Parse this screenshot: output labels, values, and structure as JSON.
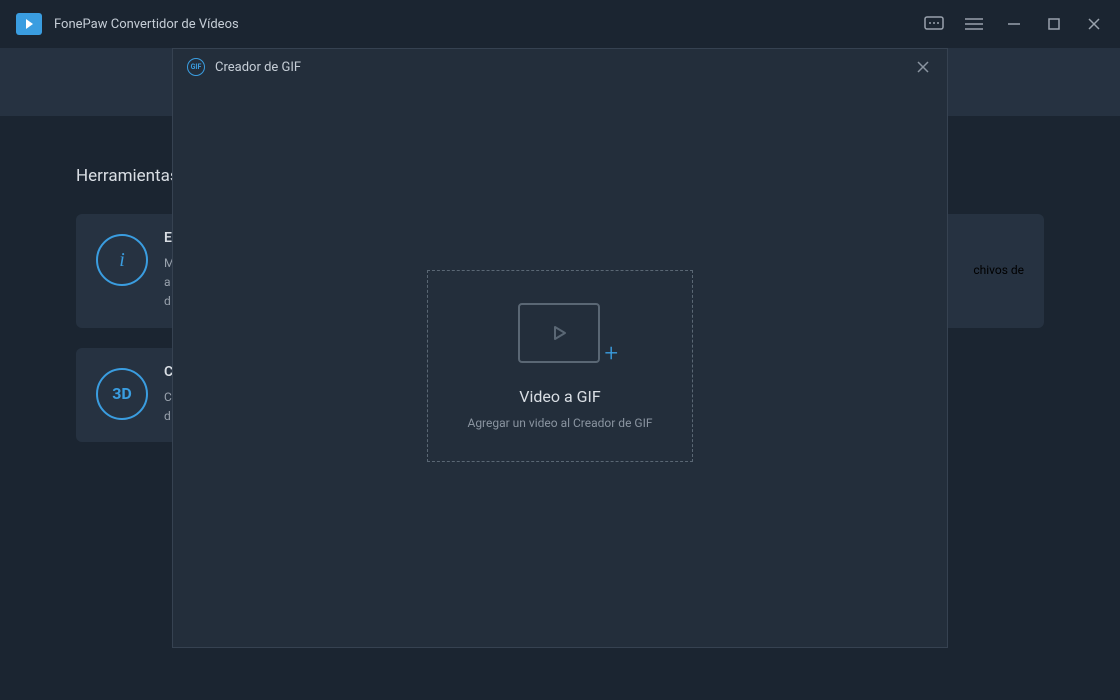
{
  "app": {
    "title": "FonePaw Convertidor de Vídeos"
  },
  "section": {
    "title": "Herramientas"
  },
  "cards": {
    "c1": {
      "title": "E",
      "desc_line1": "M",
      "desc_line2": "a",
      "desc_line3": "d"
    },
    "c2": {
      "desc": "chivos de"
    },
    "c3": {
      "title": "C",
      "desc_line1": "C",
      "desc_line2": "d"
    }
  },
  "modal": {
    "title": "Creador de GIF",
    "gif_label": "GIF",
    "dropzone": {
      "title": "Video a GIF",
      "subtitle": "Agregar un video al Creador de GIF"
    }
  }
}
